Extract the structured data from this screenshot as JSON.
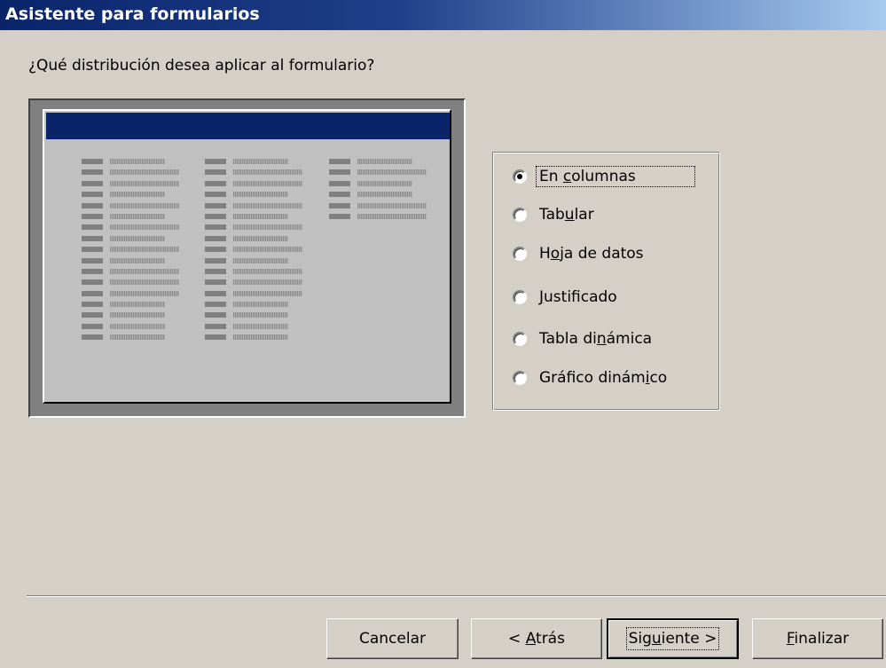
{
  "window": {
    "title": "Asistente para formularios"
  },
  "question": "¿Qué distribución desea aplicar al formulario?",
  "options": [
    {
      "label": "En columnas",
      "pre": "En ",
      "u": "c",
      "post": "olumnas",
      "selected": true
    },
    {
      "label": "Tabular",
      "pre": "Tab",
      "u": "u",
      "post": "lar",
      "selected": false
    },
    {
      "label": "Hoja de datos",
      "pre": "H",
      "u": "o",
      "post": "ja de datos",
      "selected": false
    },
    {
      "label": "Justificado",
      "pre": "",
      "u": "J",
      "post": "ustificado",
      "selected": false
    },
    {
      "label": "Tabla dinámica",
      "pre": "Tabla di",
      "u": "n",
      "post": "ámica",
      "selected": false
    },
    {
      "label": "Gráfico dinámico",
      "pre": "Gráfico dinám",
      "u": "i",
      "post": "co",
      "selected": false
    }
  ],
  "buttons": {
    "cancel": {
      "label": "Cancelar"
    },
    "back": {
      "pre": "< ",
      "u": "A",
      "post": "trás"
    },
    "next": {
      "pre": "Sig",
      "u": "u",
      "post": "iente >"
    },
    "finish": {
      "pre": "",
      "u": "F",
      "post": "inalizar"
    }
  },
  "colors": {
    "title_bar": "#0a246a",
    "dialog_bg": "#d4d0c8",
    "preview_header": "#0a246a"
  }
}
